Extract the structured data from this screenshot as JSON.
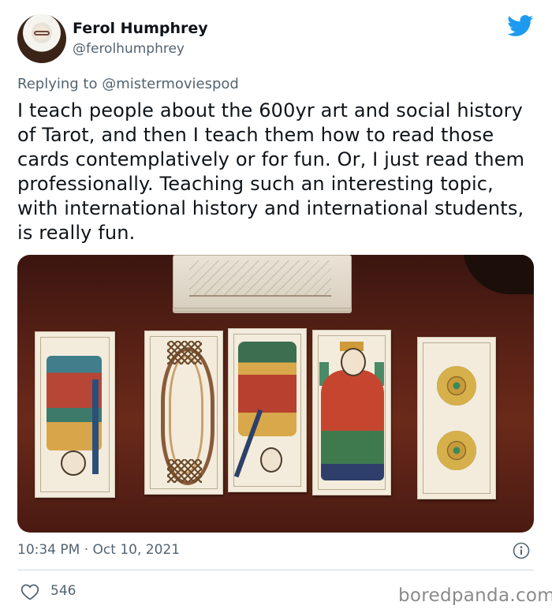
{
  "user": {
    "display_name": "Ferol Humphrey",
    "handle": "@ferolhumphrey"
  },
  "reply": {
    "prefix": "Replying to ",
    "mention": "@mistermoviespod"
  },
  "tweet": {
    "text": "I teach people about the 600yr art and social history of Tarot, and then I teach them how to read those cards contemplatively or for fun. Or, I just read them professionally. Teaching such an interesting topic, with international history and international students, is really fun.",
    "timestamp": "10:34 PM · Oct 10, 2021",
    "likes": "546"
  },
  "icons": {
    "brand": "twitter-bird-icon",
    "info": "info-icon",
    "like": "heart-icon"
  },
  "colors": {
    "twitter_blue": "#1d9bf0",
    "secondary_text": "#536471",
    "primary_text": "#0f1419",
    "divider": "#cfd9de"
  },
  "watermark": "boredpanda.com"
}
